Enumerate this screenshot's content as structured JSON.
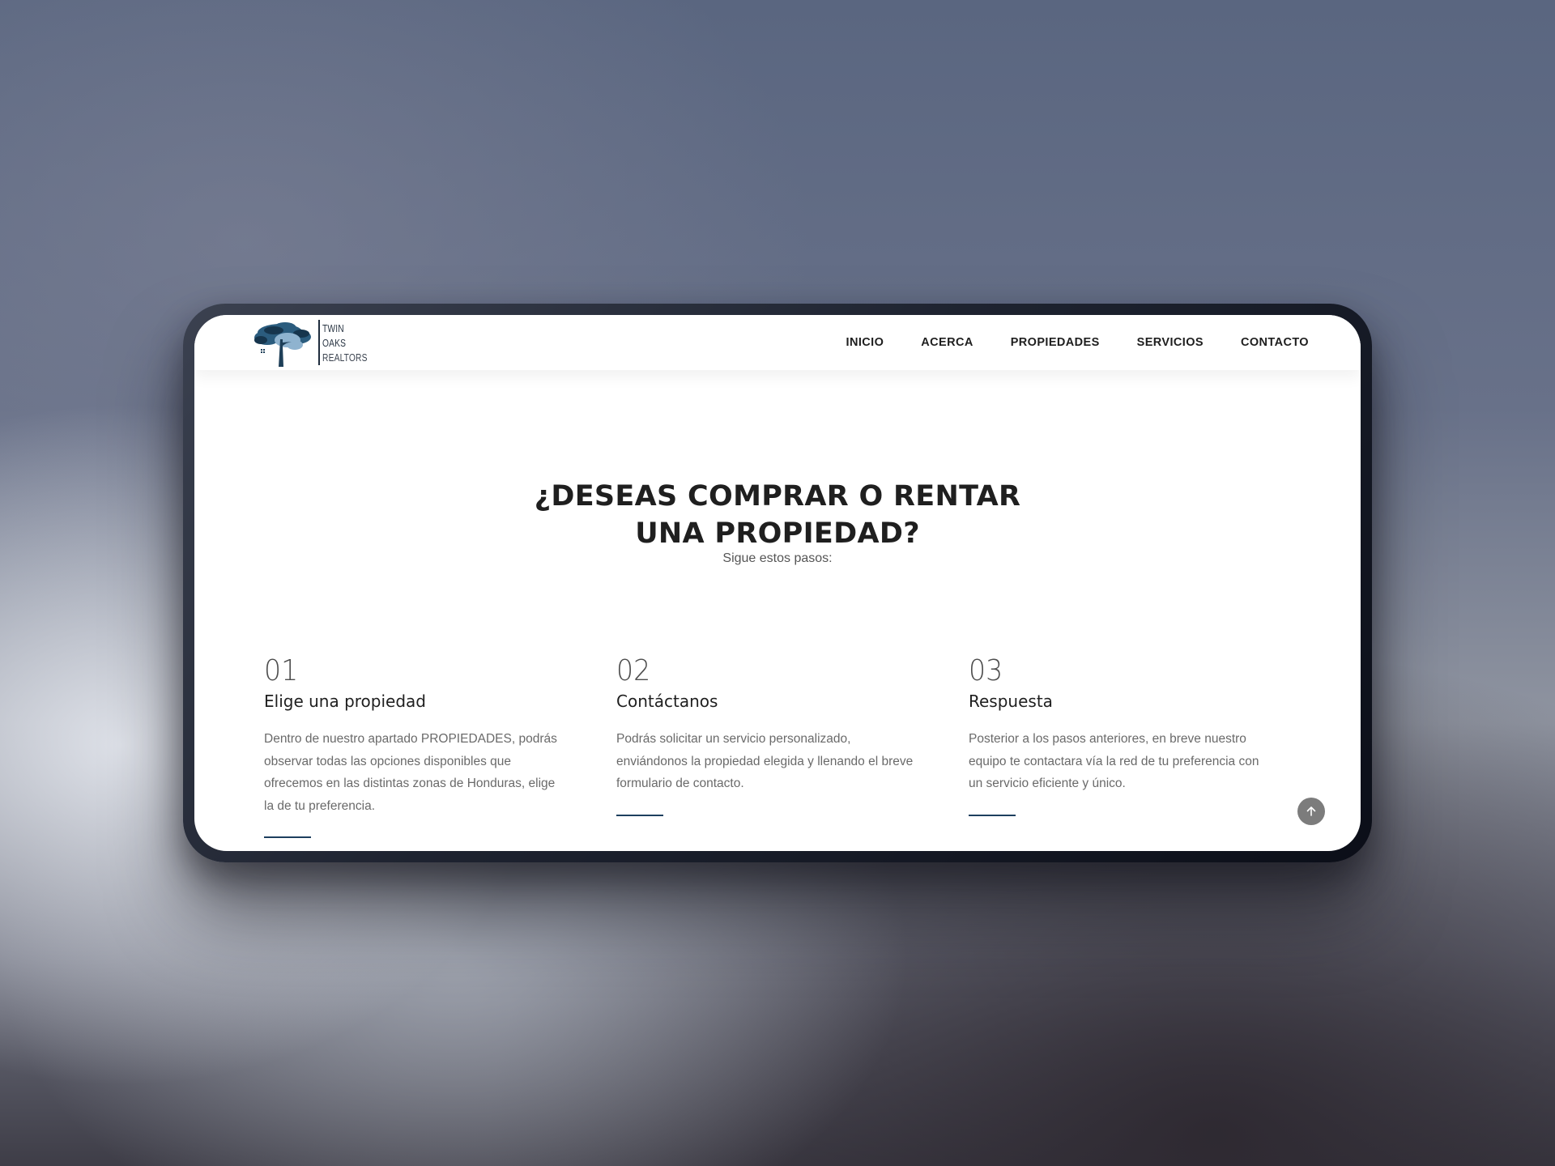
{
  "header": {
    "logo": {
      "line1": "TWIN",
      "line2": "OAKS",
      "line3": "REALTORS"
    },
    "nav": [
      {
        "label": "INICIO"
      },
      {
        "label": "ACERCA"
      },
      {
        "label": "PROPIEDADES"
      },
      {
        "label": "SERVICIOS"
      },
      {
        "label": "CONTACTO"
      }
    ]
  },
  "hero": {
    "title_line1": "¿DESEAS COMPRAR O RENTAR",
    "title_line2": "UNA PROPIEDAD?",
    "subtitle": "Sigue estos pasos:"
  },
  "steps": [
    {
      "number": "01",
      "title": "Elige una propiedad",
      "body": "Dentro de nuestro apartado PROPIEDADES, podrás observar todas las opciones disponibles que ofrecemos en las distintas zonas de Honduras, elige la de tu preferencia."
    },
    {
      "number": "02",
      "title": "Contáctanos",
      "body": "Podrás solicitar un servicio personalizado, enviándonos la propiedad elegida y llenando el breve formulario de contacto."
    },
    {
      "number": "03",
      "title": "Respuesta",
      "body": "Posterior a los pasos anteriores, en breve nuestro equipo te contactara vía la red de tu preferencia con un servicio eficiente y único."
    }
  ],
  "colors": {
    "accent": "#1d3f5e",
    "logo_tree": "#2b5c7e",
    "text_dark": "#1f1f1f",
    "text_muted": "#6a6a6a"
  },
  "icons": {
    "scroll_top": "arrow-up-icon",
    "logo": "oak-tree-icon"
  }
}
